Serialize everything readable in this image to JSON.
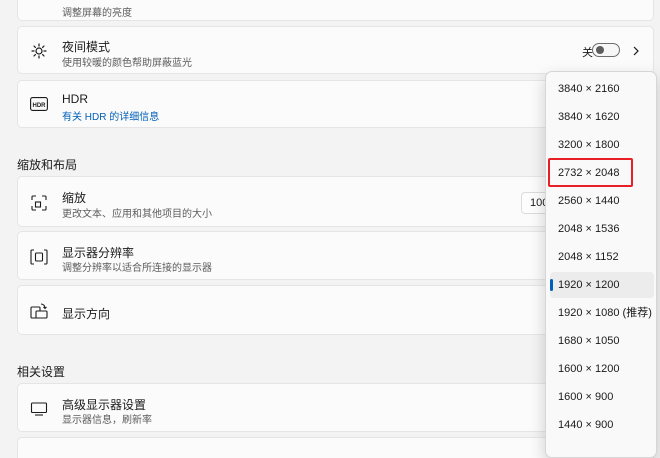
{
  "brightness": {
    "subtitle": "调整屏幕的亮度"
  },
  "night_mode": {
    "title": "夜间模式",
    "subtitle": "使用较暖的颜色帮助屏蔽蓝光",
    "state_label": "关",
    "enabled": false
  },
  "hdr": {
    "badge": "HDR",
    "title": "HDR",
    "link": "有关 HDR 的详细信息"
  },
  "section_scale_layout": "缩放和布局",
  "zoom": {
    "title": "缩放",
    "subtitle": "更改文本、应用和其他项目的大小",
    "value": "100"
  },
  "resolution": {
    "title": "显示器分辨率",
    "subtitle": "调整分辨率以适合所连接的显示器"
  },
  "orientation": {
    "title": "显示方向"
  },
  "section_related": "相关设置",
  "advanced_display": {
    "title": "高级显示器设置",
    "subtitle": "显示器信息，刷新率"
  },
  "resolution_options": [
    "3840 × 2160",
    "3840 × 1620",
    "3200 × 1800",
    "2732 × 2048",
    "2560 × 1440",
    "2048 × 1536",
    "2048 × 1152",
    "1920 × 1200",
    "1920 × 1080 (推荐)",
    "1680 × 1050",
    "1600 × 1200",
    "1600 × 900",
    "1440 × 900"
  ],
  "selected_option": "1920 × 1200",
  "highlighted_option": "2732 × 2048",
  "colors": {
    "accent": "#005fb8",
    "highlight_border": "#e81f25",
    "background": "#f3f3f3",
    "card": "#fbfbfb"
  }
}
